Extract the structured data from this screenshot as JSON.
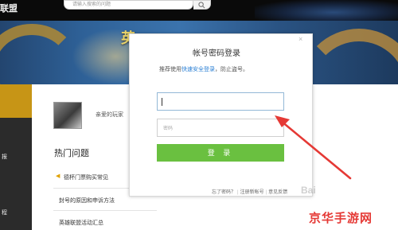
{
  "header": {
    "brand_partial": "联盟",
    "search_placeholder": "请输入搜索的问题"
  },
  "banner": {
    "title_partial": "英"
  },
  "left_nav": {
    "items": [
      "报",
      "程"
    ]
  },
  "page": {
    "avatar_greeting": "亲爱的玩家",
    "hot_section_title": "热门问题",
    "hot_items": [
      "德杯门票购买常见",
      "封号的原因和申诉方法",
      "英雄联盟活动汇总"
    ]
  },
  "login_modal": {
    "title": "帐号密码登录",
    "subtitle_prefix": "推荐使用",
    "subtitle_link": "快速安全登录",
    "subtitle_suffix": "，防止盗号。",
    "account_value": "",
    "password_placeholder": "密码",
    "login_button": "登 录",
    "forgot_link": "忘了密码？",
    "register_link": "注册新帐号",
    "feedback_link": "意见反馈",
    "separator": "|",
    "close_glyph": "×"
  },
  "colors": {
    "accent_green": "#6ac040",
    "link_blue": "#2a7fd4",
    "annotation_red": "#e53935",
    "nav_active_gold": "#c79516"
  },
  "watermarks": {
    "site": "京华手游网",
    "baidu": "Bai"
  }
}
